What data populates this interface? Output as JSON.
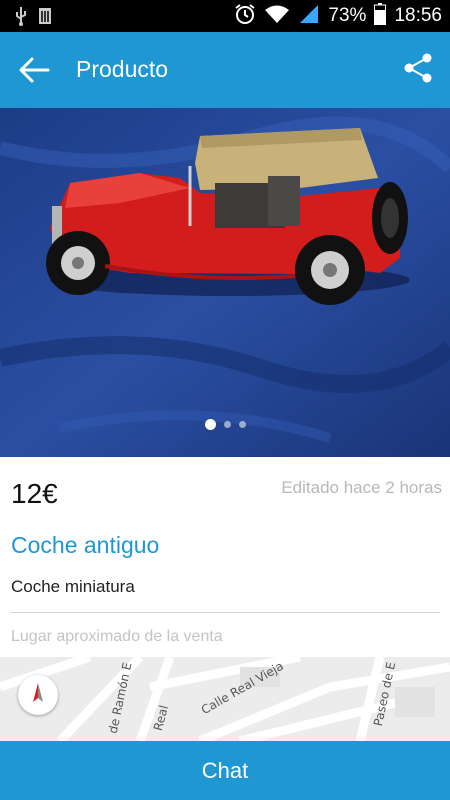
{
  "status_bar": {
    "battery": "73%",
    "time": "18:56",
    "icons": [
      "usb-icon",
      "sim-card-icon",
      "alarm-icon",
      "wifi-icon",
      "signal-icon",
      "battery-icon"
    ]
  },
  "app_bar": {
    "title": "Producto",
    "back_icon": "arrow-left-icon",
    "share_icon": "share-icon",
    "color": "#1e97d3"
  },
  "gallery": {
    "image_count": 3,
    "active_index": 0
  },
  "product": {
    "price": "12€",
    "edited": "Editado hace 2 horas",
    "title": "Coche antiguo",
    "description": "Coche miniatura"
  },
  "location": {
    "label": "Lugar aproximado de la venta",
    "streets": [
      "de Ramón E",
      "Real",
      "Calle Real Vieja",
      "Paseo de E"
    ],
    "compass_icon": "compass-icon"
  },
  "chat_button": {
    "label": "Chat"
  }
}
